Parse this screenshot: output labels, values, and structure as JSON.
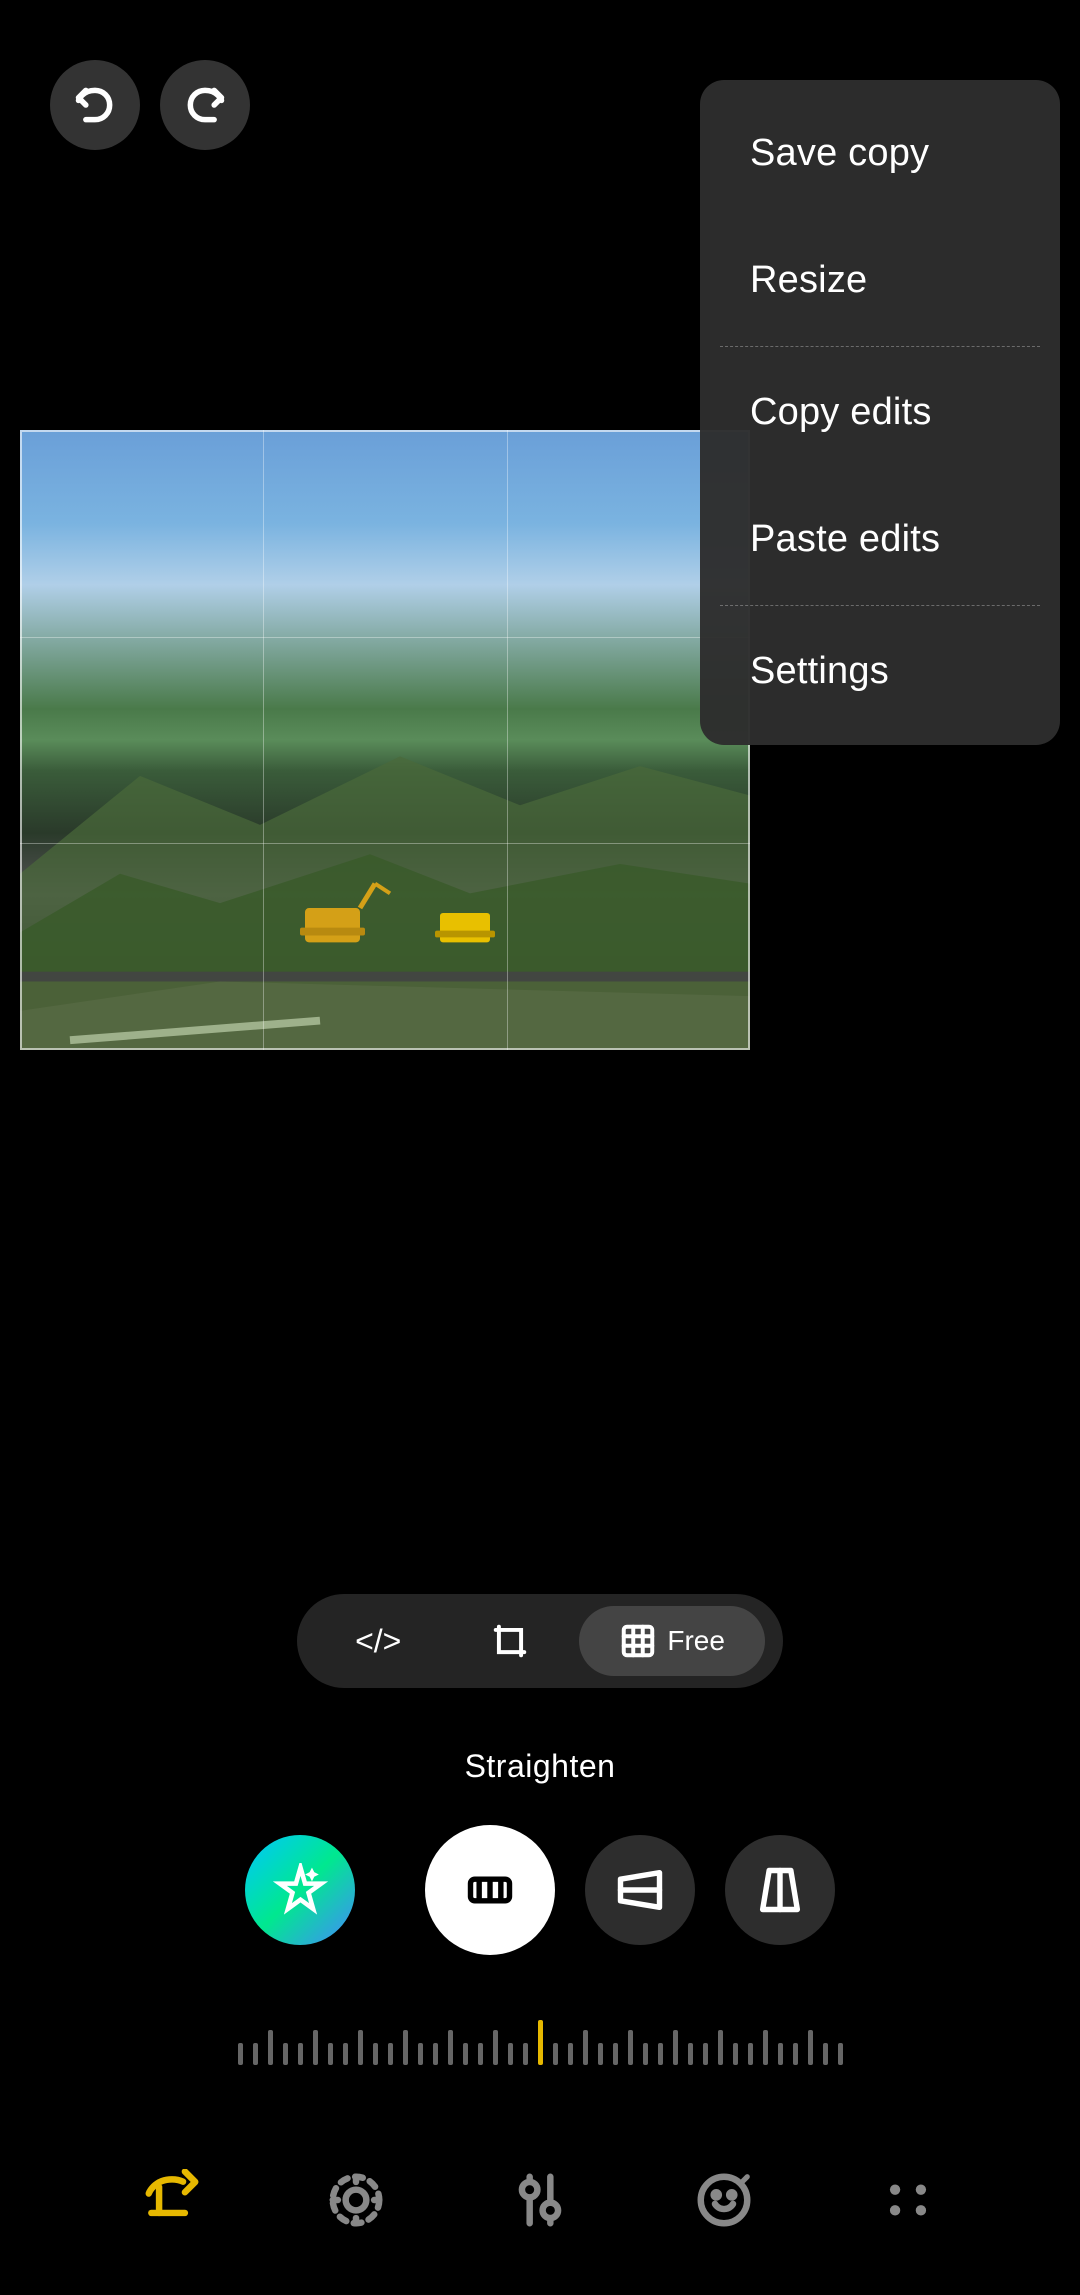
{
  "menu": {
    "items": [
      {
        "id": "save-copy",
        "label": "Save copy",
        "hasDividerAfter": false
      },
      {
        "id": "resize",
        "label": "Resize",
        "hasDividerAfter": true
      },
      {
        "id": "copy-edits",
        "label": "Copy edits",
        "hasDividerAfter": false
      },
      {
        "id": "paste-edits",
        "label": "Paste edits",
        "hasDividerAfter": true
      },
      {
        "id": "settings",
        "label": "Settings",
        "hasDividerAfter": false
      }
    ]
  },
  "toolbar": {
    "undo_label": "Undo",
    "redo_label": "Redo"
  },
  "mode_pills": [
    {
      "id": "transform",
      "label": "</>",
      "active": false
    },
    {
      "id": "crop",
      "label": "⬜",
      "active": false
    },
    {
      "id": "free",
      "label": "Free",
      "active": true
    }
  ],
  "straighten": {
    "label": "Straighten"
  },
  "transform_buttons": [
    {
      "id": "straighten-btn",
      "active": true
    },
    {
      "id": "perspective-h-btn",
      "active": false
    },
    {
      "id": "perspective-v-btn",
      "active": false
    }
  ],
  "bottom_nav": [
    {
      "id": "crop-nav",
      "icon": "crop-rotate-icon",
      "color": "#e6b800"
    },
    {
      "id": "adjust-nav",
      "icon": "adjust-icon",
      "color": "#aaa"
    },
    {
      "id": "filter-nav",
      "icon": "filter-icon",
      "color": "#aaa"
    },
    {
      "id": "markup-nav",
      "icon": "markup-icon",
      "color": "#aaa"
    },
    {
      "id": "more-nav",
      "icon": "more-icon",
      "color": "#aaa"
    }
  ]
}
